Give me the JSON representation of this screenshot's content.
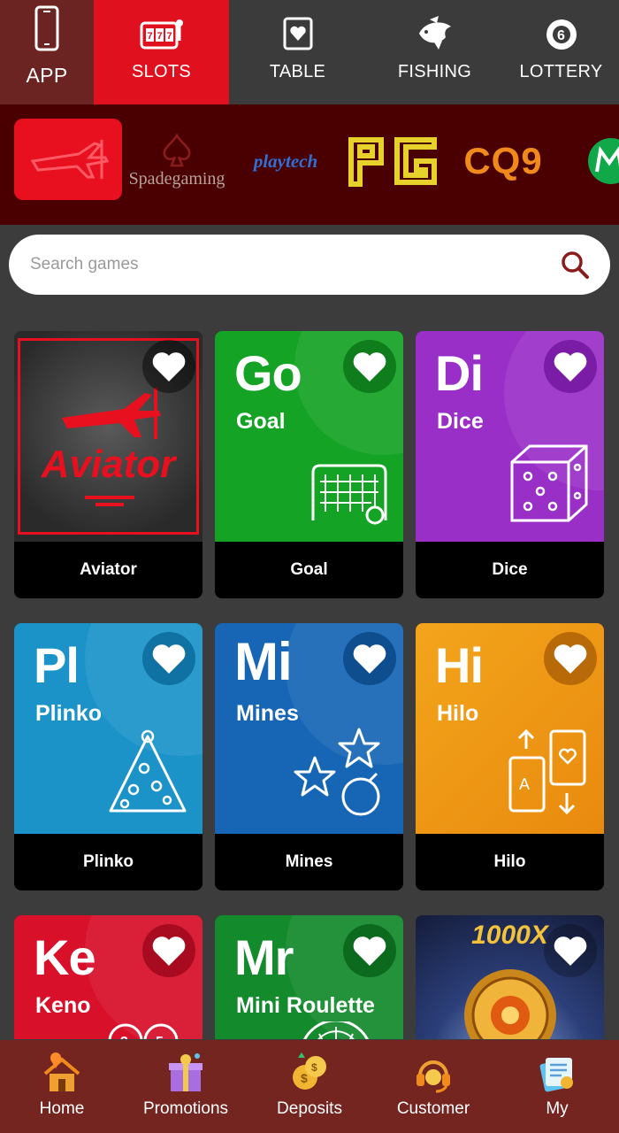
{
  "top_nav": {
    "items": [
      {
        "label": "APP",
        "icon": "phone-icon",
        "active": false
      },
      {
        "label": "SLOTS",
        "icon": "slot-machine-icon",
        "active": true
      },
      {
        "label": "TABLE",
        "icon": "playing-card-icon",
        "active": false
      },
      {
        "label": "FISHING",
        "icon": "fish-icon",
        "active": false
      },
      {
        "label": "LOTTERY",
        "icon": "lottery-ball-icon",
        "active": false
      }
    ]
  },
  "providers": {
    "items": [
      {
        "name": "aviator",
        "icon": "plane-icon"
      },
      {
        "name": "Spadegaming",
        "icon": "spade-icon"
      },
      {
        "name": "playtech"
      },
      {
        "name": "PG"
      },
      {
        "name": "CQ9"
      },
      {
        "name": "microgaming",
        "icon": "m-logo-icon"
      }
    ]
  },
  "search": {
    "placeholder": "Search games"
  },
  "games": [
    {
      "title": "Aviator",
      "logo_text": "Aviator",
      "theme": "#3a3a3a"
    },
    {
      "title": "Goal",
      "abbr": "Go",
      "sub": "Goal",
      "theme": "#14a324"
    },
    {
      "title": "Dice",
      "abbr": "Di",
      "sub": "Dice",
      "theme": "#9a2fc8"
    },
    {
      "title": "Plinko",
      "abbr": "Pl",
      "sub": "Plinko",
      "theme": "#1b93c9"
    },
    {
      "title": "Mines",
      "abbr": "Mi",
      "sub": "Mines",
      "theme": "#1766b5"
    },
    {
      "title": "Hilo",
      "abbr": "Hi",
      "sub": "Hilo",
      "theme": "#ee9a12"
    },
    {
      "title": "Keno",
      "abbr": "Ke",
      "sub": "Keno",
      "theme": "#d8102a"
    },
    {
      "title": "Mini Roulette",
      "abbr": "Mr",
      "sub": "Mini Roulette",
      "theme": "#138a2c"
    },
    {
      "title": "",
      "badge": "1000X",
      "theme": "#1c2a55"
    }
  ],
  "bottom_nav": {
    "items": [
      {
        "label": "Home",
        "icon": "house-icon"
      },
      {
        "label": "Promotions",
        "icon": "gift-icon"
      },
      {
        "label": "Deposits",
        "icon": "coins-icon"
      },
      {
        "label": "Customer",
        "icon": "headset-icon"
      },
      {
        "label": "My",
        "icon": "profile-card-icon"
      }
    ]
  },
  "colors": {
    "accent_red": "#e0101e",
    "dark_red": "#742520",
    "provider_bg": "#4a0000",
    "page_bg": "#3c3c3c",
    "search_icon": "#8a1c1c"
  }
}
